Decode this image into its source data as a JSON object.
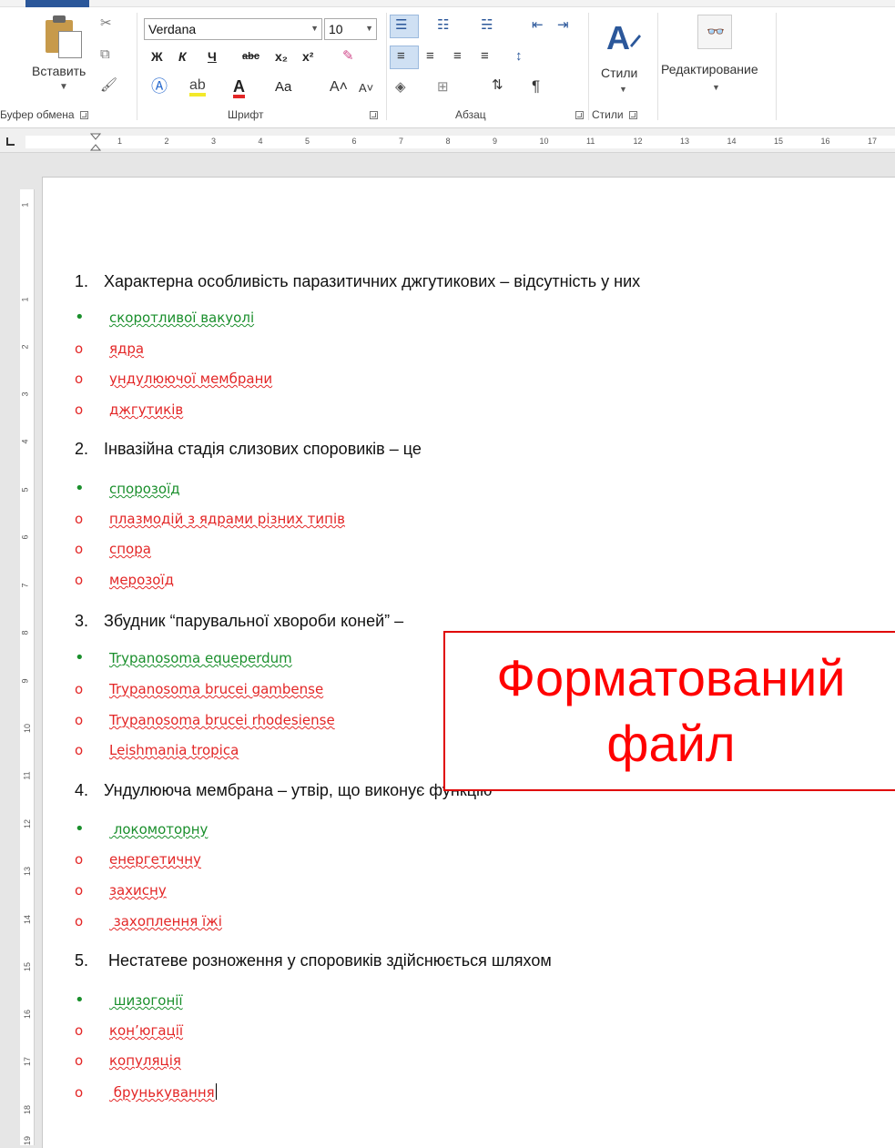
{
  "ribbon": {
    "paste_label": "Вставить",
    "font_name": "Verdana",
    "font_size": "10",
    "styles_label": "Стили",
    "editing_label": "Редактирование",
    "groups": {
      "clipboard": "Буфер обмена",
      "font": "Шрифт",
      "paragraph": "Абзац",
      "styles": "Стили"
    },
    "font_buttons": {
      "bold": "Ж",
      "italic": "К",
      "underline": "Ч",
      "strikethrough": "abc",
      "subscript": "x₂",
      "superscript": "x²",
      "case": "Aa"
    }
  },
  "ruler": {
    "numbers": [
      "1",
      "2",
      "3",
      "4",
      "5",
      "6",
      "7",
      "8",
      "9",
      "10",
      "11",
      "12",
      "13",
      "14",
      "15",
      "16",
      "17"
    ],
    "vertical_numbers": [
      "1",
      "1",
      "2",
      "3",
      "4",
      "5",
      "6",
      "7",
      "8",
      "9",
      "10",
      "11",
      "12",
      "13",
      "14",
      "15",
      "16",
      "17",
      "18",
      "19"
    ]
  },
  "document": {
    "questions": [
      {
        "number": "1.",
        "text": "Характерна особливість паразитичних джгутикових – відсутність у них",
        "options": [
          {
            "marker": "•",
            "text": "скоротливої вакуолі",
            "correct": true
          },
          {
            "marker": "o",
            "text": "ядра",
            "correct": false
          },
          {
            "marker": "o",
            "text": "ундулюючої мембрани",
            "correct": false
          },
          {
            "marker": "o",
            "text": "джгутиків",
            "correct": false
          }
        ]
      },
      {
        "number": "2.",
        "text": "Інвазійна стадія слизових споровиків – це",
        "options": [
          {
            "marker": "•",
            "text": "спорозоїд",
            "correct": true
          },
          {
            "marker": "o",
            "text": "плазмодій з ядрами різних типів",
            "correct": false
          },
          {
            "marker": "o",
            "text": "спора",
            "correct": false
          },
          {
            "marker": "o",
            "text": "мерозоїд",
            "correct": false
          }
        ]
      },
      {
        "number": "3.",
        "text": "Збудник “парувальної хвороби коней” –",
        "options": [
          {
            "marker": "•",
            "text": "Trypanosoma equeperdum",
            "correct": true
          },
          {
            "marker": "o",
            "text": "Trypanosoma brucei gambense",
            "correct": false
          },
          {
            "marker": "o",
            "text": "Trypanosoma brucei rhodesiense",
            "correct": false
          },
          {
            "marker": "o",
            "text": "Leishmania tropica",
            "correct": false
          }
        ]
      },
      {
        "number": "4.",
        "text": "Ундулююча мембрана – утвір, що виконує функцію",
        "options": [
          {
            "marker": "•",
            "text": " локомоторну",
            "correct": true
          },
          {
            "marker": "o",
            "text": "енергетичну",
            "correct": false
          },
          {
            "marker": "o",
            "text": "захисну",
            "correct": false
          },
          {
            "marker": "o",
            "text": " захоплення їжі",
            "correct": false
          }
        ]
      },
      {
        "number": "5.",
        "text": " Нестатеве розноження у споровиків здійснюється шляхом",
        "options": [
          {
            "marker": "•",
            "text": " шизогонії",
            "correct": true
          },
          {
            "marker": "o",
            "text": "кон’югації",
            "correct": false
          },
          {
            "marker": "o",
            "text": "копуляція",
            "correct": false
          },
          {
            "marker": "o",
            "text": " брунькування",
            "correct": false
          }
        ]
      }
    ]
  },
  "overlay": {
    "line1": "Форматований",
    "line2": "файл"
  },
  "colors": {
    "correct": "#1a8f2c",
    "wrong": "#e32626",
    "overlay": "#ff0000",
    "word_blue": "#2b579a"
  }
}
